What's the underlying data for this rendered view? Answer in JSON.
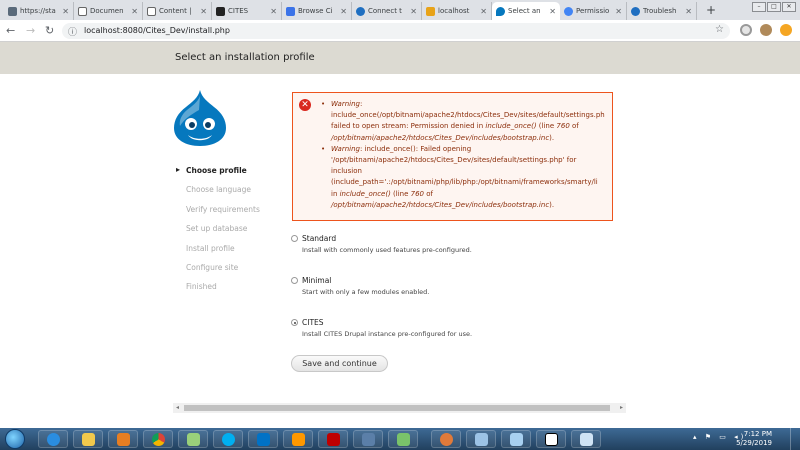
{
  "browser": {
    "tabs": [
      {
        "label": "https://sta",
        "favicon": "adc-icon",
        "color": "#5a6a7a"
      },
      {
        "label": "Documen",
        "favicon": "document-icon",
        "color": "#ffffff"
      },
      {
        "label": "Content |",
        "favicon": "document-icon",
        "color": "#ffffff"
      },
      {
        "label": "CITES",
        "favicon": "cites-icon",
        "color": "#222222"
      },
      {
        "label": "Browse Ci",
        "favicon": "bookmark-icon",
        "color": "#3b73e8"
      },
      {
        "label": "Connect t",
        "favicon": "b-icon",
        "color": "#1f6fc1"
      },
      {
        "label": "localhost",
        "favicon": "chart-icon",
        "color": "#e8a319"
      },
      {
        "label": "Select an",
        "favicon": "drupal-icon",
        "color": "#0678be"
      },
      {
        "label": "Permissio",
        "favicon": "google-icon",
        "color": "#4285f4"
      },
      {
        "label": "Troublesh",
        "favicon": "b-icon",
        "color": "#1f6fc1"
      }
    ],
    "url": "localhost:8080/Cites_Dev/install.php"
  },
  "page": {
    "title": "Select an installation profile"
  },
  "steps": [
    {
      "label": "Choose profile",
      "active": true
    },
    {
      "label": "Choose language",
      "active": false
    },
    {
      "label": "Verify requirements",
      "active": false
    },
    {
      "label": "Set up database",
      "active": false
    },
    {
      "label": "Install profile",
      "active": false
    },
    {
      "label": "Configure site",
      "active": false
    },
    {
      "label": "Finished",
      "active": false
    }
  ],
  "errors": {
    "warning_label": "Warning",
    "w1_line1": "include_once(/opt/bitnami/apache2/htdocs/Cites_Dev/sites/default/settings.ph",
    "w1_line2_pre": "failed to open stream: Permission denied in ",
    "w1_line2_em": "include_once()",
    "w1_line2_post": " (line ",
    "w1_line2_num": "760",
    "w1_line2_end": " of",
    "w1_line3": "/opt/bitnami/apache2/htdocs/Cites_Dev/includes/bootstrap.inc",
    "w2_line1_rest": ": include_once(): Failed opening",
    "w2_line2": "'/opt/bitnami/apache2/htdocs/Cites_Dev/sites/default/settings.php' for",
    "w2_line3": "inclusion",
    "w2_line4": "(include_path='.:/opt/bitnami/php/lib/php:/opt/bitnami/frameworks/smarty/li",
    "w2_line5_pre": "in ",
    "w2_line5_em": "include_once()",
    "w2_line5_post": " (line ",
    "w2_line5_num": "760",
    "w2_line5_end": " of",
    "w2_line6": "/opt/bitnami/apache2/htdocs/Cites_Dev/includes/bootstrap.inc"
  },
  "profiles": [
    {
      "name": "Standard",
      "description": "Install with commonly used features pre-configured.",
      "checked": false
    },
    {
      "name": "Minimal",
      "description": "Start with only a few modules enabled.",
      "checked": false
    },
    {
      "name": "CITES",
      "description": "Install CITES Drupal instance pre-configured for use.",
      "checked": true
    }
  ],
  "form": {
    "submit_label": "Save and continue"
  },
  "taskbar": {
    "time": "7:12 PM",
    "date": "5/29/2019",
    "apps": [
      "ie-icon",
      "explorer-icon",
      "media-player-icon",
      "chrome-icon",
      "cloud-app-icon",
      "skype-icon",
      "outlook-icon",
      "sublime-icon",
      "filezilla-icon",
      "network-icon",
      "gem-icon",
      "paint-icon",
      "screenshot-icon",
      "notes-icon",
      "7zip-icon",
      "paintbrush-icon"
    ]
  }
}
